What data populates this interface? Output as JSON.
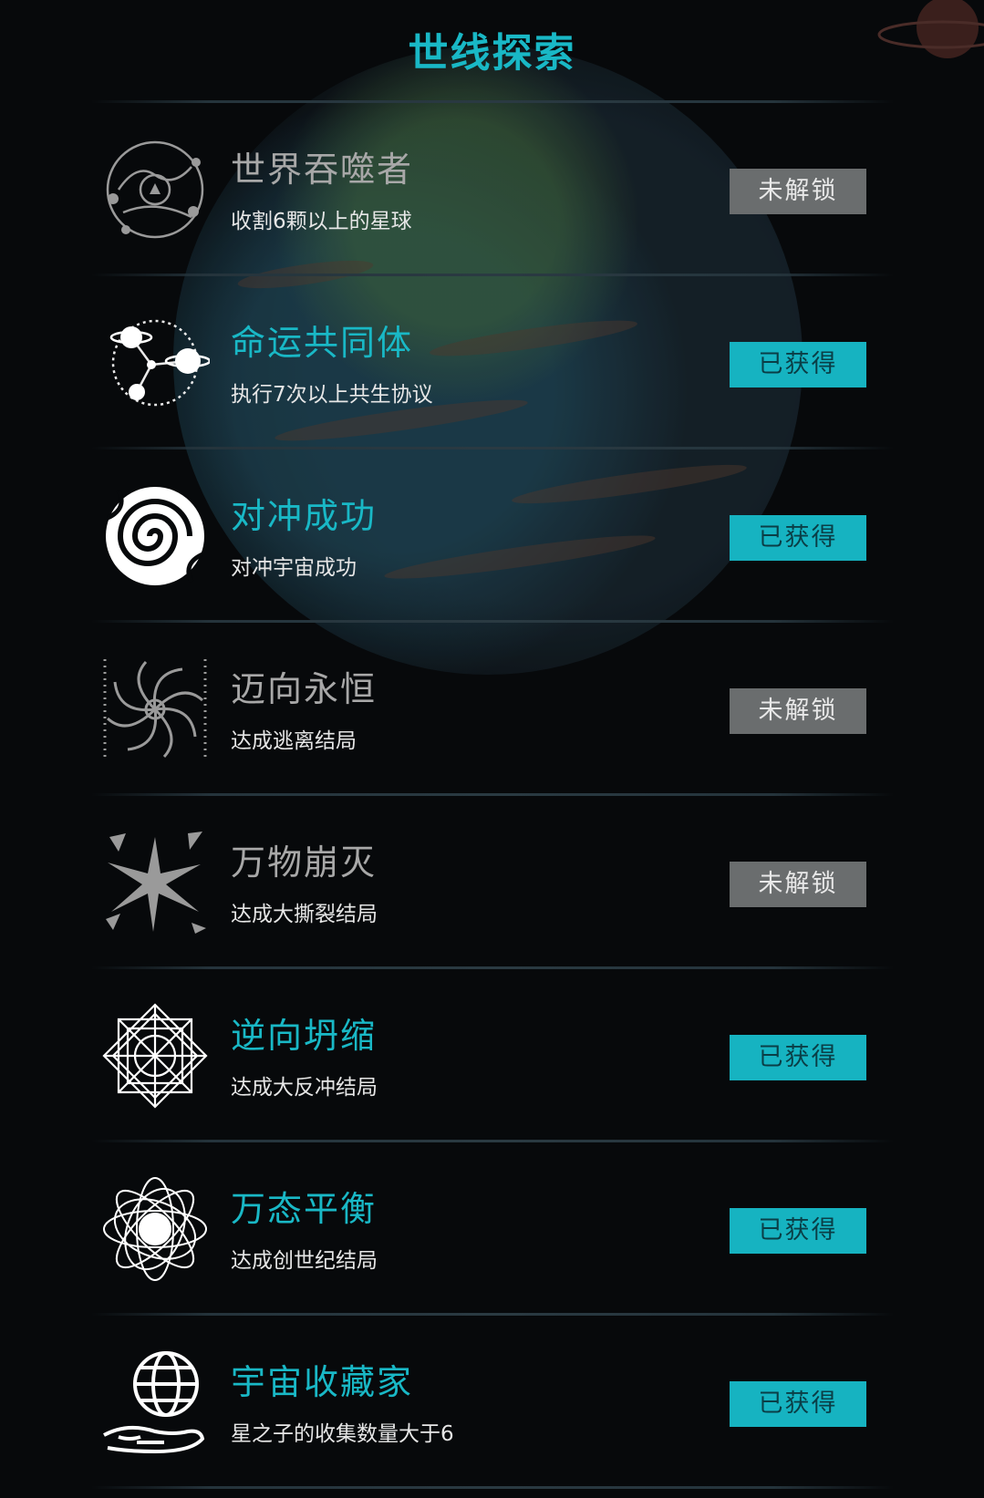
{
  "title": "世线探索",
  "colors": {
    "accent": "#19b8c6",
    "locked_button": "#6a6d6e",
    "obtained_button": "#16b3c1"
  },
  "achievements": [
    {
      "name": "世界吞噬者",
      "desc": "收割6颗以上的星球",
      "status": "未解锁",
      "state": "locked",
      "icon": "planet-orbit-icon"
    },
    {
      "name": "命运共同体",
      "desc": "执行7次以上共生协议",
      "status": "已获得",
      "state": "obtained",
      "icon": "linked-planets-icon"
    },
    {
      "name": "对冲成功",
      "desc": "对冲宇宙成功",
      "status": "已获得",
      "state": "obtained",
      "icon": "spiral-icon"
    },
    {
      "name": "迈向永恒",
      "desc": "达成逃离结局",
      "status": "未解锁",
      "state": "locked",
      "icon": "galaxy-icon"
    },
    {
      "name": "万物崩灭",
      "desc": "达成大撕裂结局",
      "status": "未解锁",
      "state": "locked",
      "icon": "burst-icon"
    },
    {
      "name": "逆向坍缩",
      "desc": "达成大反冲结局",
      "status": "已获得",
      "state": "obtained",
      "icon": "crystal-icon"
    },
    {
      "name": "万态平衡",
      "desc": "达成创世纪结局",
      "status": "已获得",
      "state": "obtained",
      "icon": "atom-orbits-icon"
    },
    {
      "name": "宇宙收藏家",
      "desc": "星之子的收集数量大于6",
      "status": "已获得",
      "state": "obtained",
      "icon": "hand-globe-icon"
    }
  ]
}
